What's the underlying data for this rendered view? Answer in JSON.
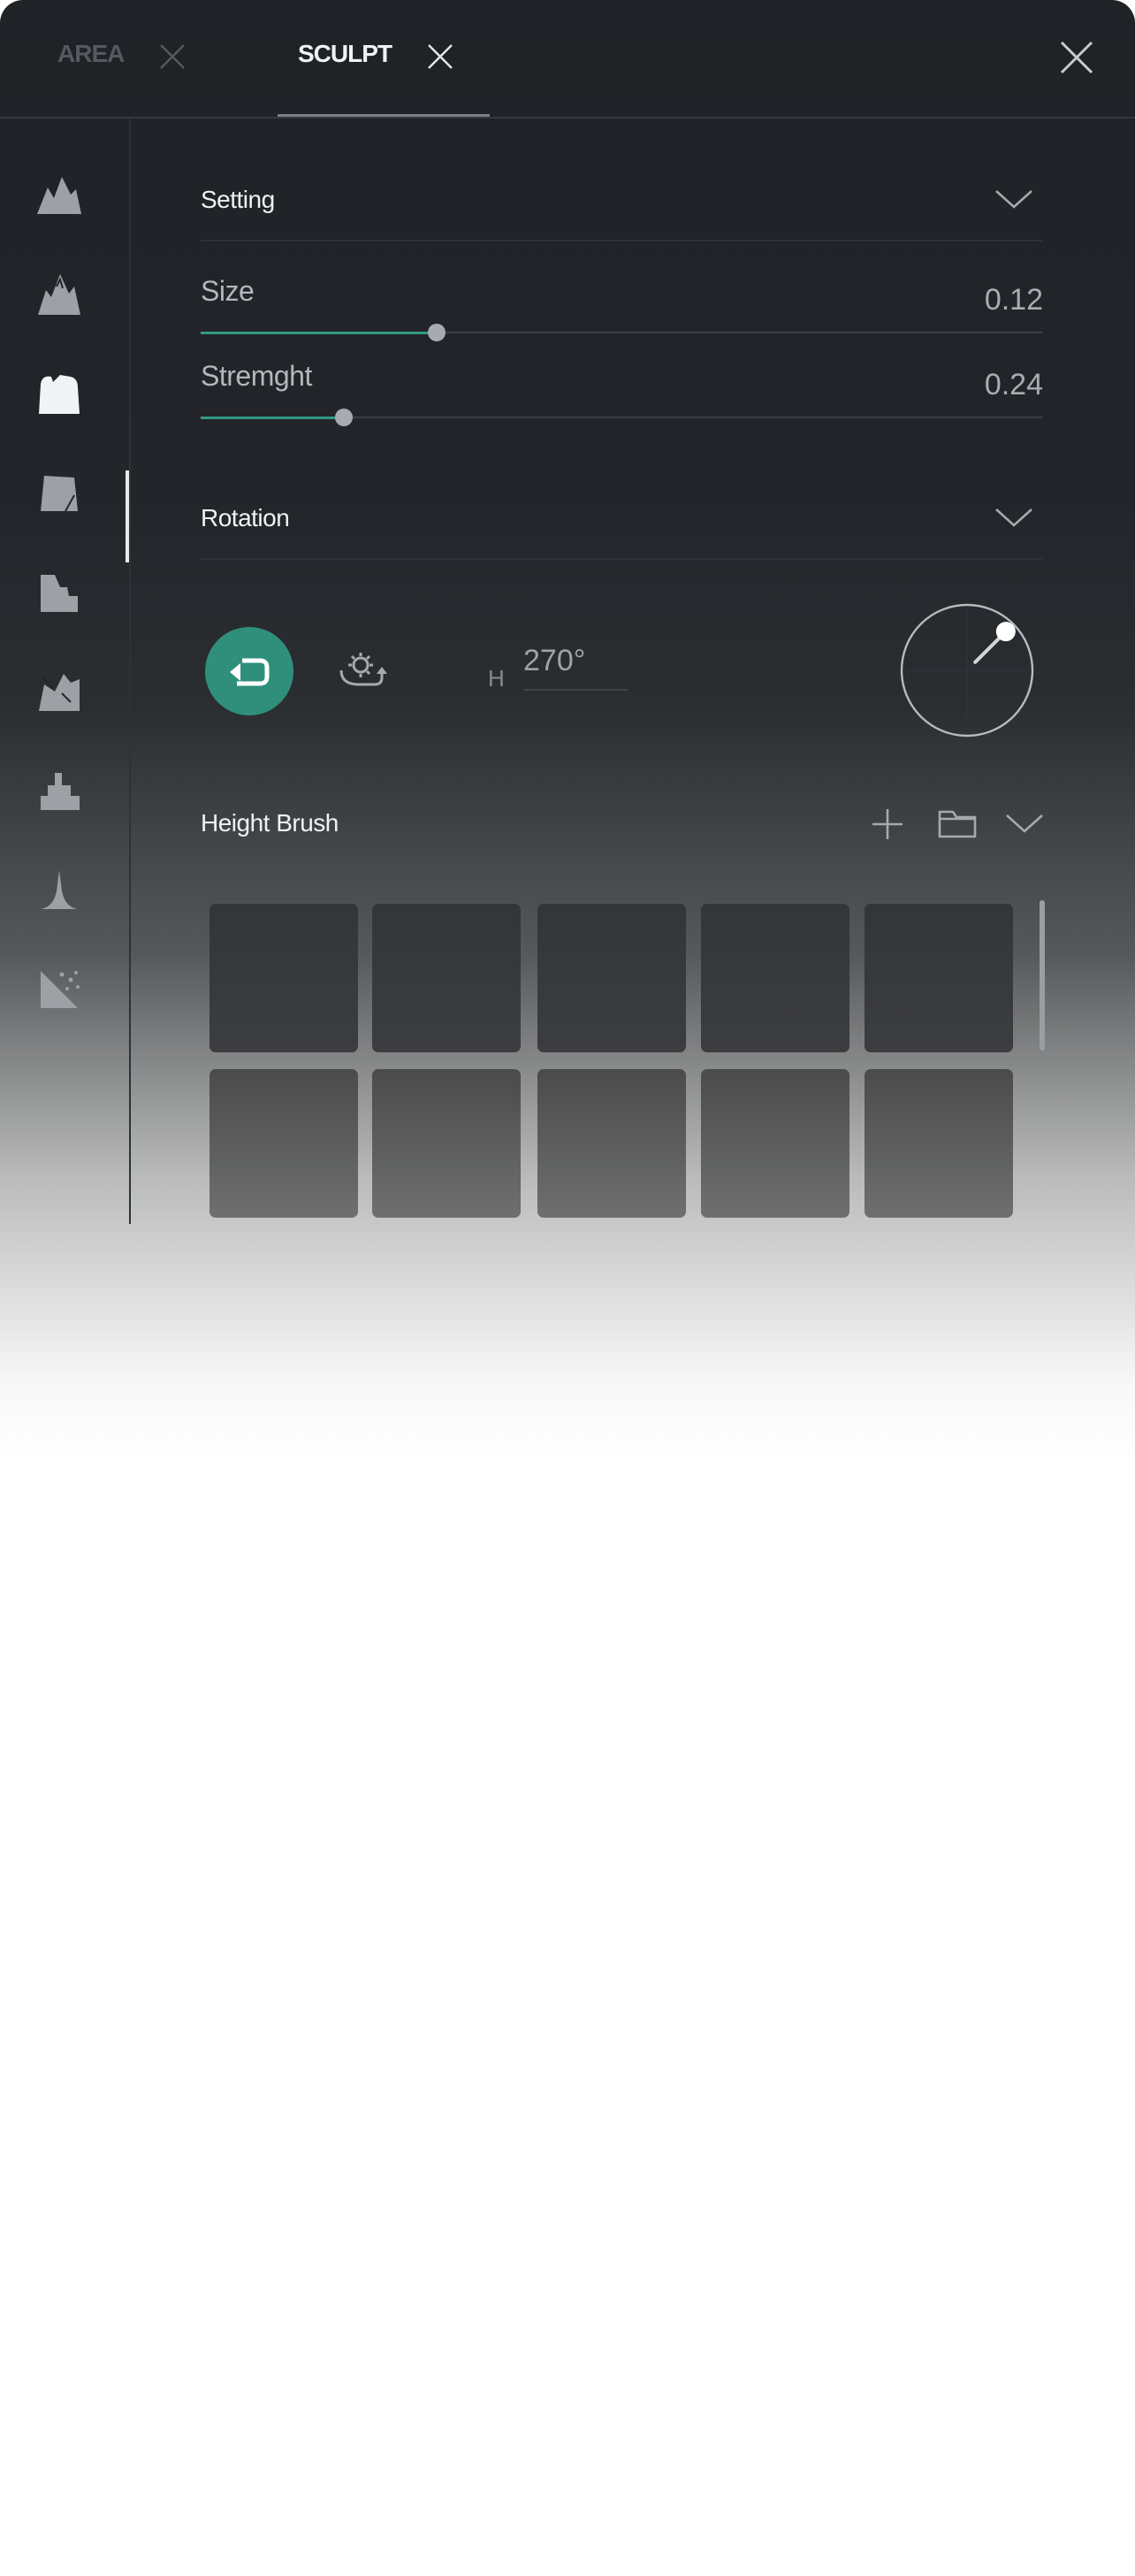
{
  "tabs": [
    {
      "label": "AREA",
      "active": false
    },
    {
      "label": "SCULPT",
      "active": true
    }
  ],
  "sidebar": {
    "items": [
      {
        "icon": "mountains-icon"
      },
      {
        "icon": "mountain-peak-icon"
      },
      {
        "icon": "plateau-icon",
        "active": true
      },
      {
        "icon": "cliff-block-icon"
      },
      {
        "icon": "terrace-icon"
      },
      {
        "icon": "erosion-icon"
      },
      {
        "icon": "stairs-icon"
      },
      {
        "icon": "spike-icon"
      },
      {
        "icon": "scatter-icon"
      }
    ]
  },
  "setting": {
    "title": "Setting",
    "sliders": [
      {
        "label": "Size",
        "value": "0.12",
        "level": 0.28
      },
      {
        "label": "Stremght",
        "value": "0.24",
        "level": 0.17
      }
    ]
  },
  "rotation": {
    "title": "Rotation",
    "h_label": "H",
    "h_value": "270°",
    "dial_angle_deg": 315
  },
  "height_brush": {
    "title": "Height Brush",
    "rows": 2,
    "columns": 5
  },
  "colors": {
    "accent": "#2f9b85",
    "panel": "#1f2226"
  }
}
